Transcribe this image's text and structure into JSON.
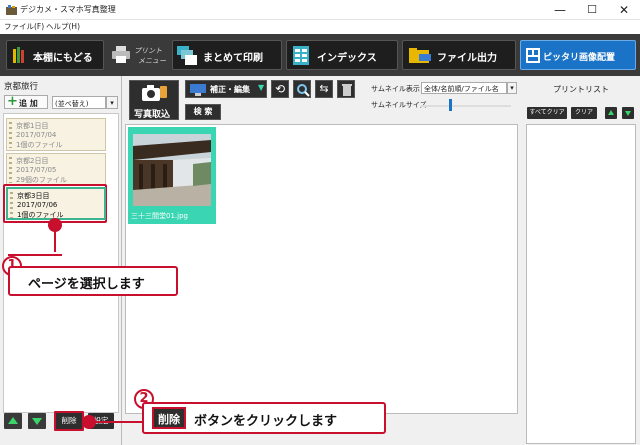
{
  "window": {
    "title": "デジカメ・スマホ写真整理",
    "minimize": "—",
    "maximize": "☐",
    "close": "✕"
  },
  "menu": {
    "file": "ファイル(F)",
    "help": "ヘルプ(H)"
  },
  "toolbar": {
    "back_to_shelf": "本棚にもどる",
    "print_menu_line1": "プリント",
    "print_menu_line2": "メニュー",
    "batch_print": "まとめて印刷",
    "index": "インデックス",
    "file_output": "ファイル出力",
    "fit_layout": "ピッタリ画像配置"
  },
  "left_panel": {
    "album_title": "京都旅行",
    "add_label": "追 加",
    "sort_label": "(並べ替え)",
    "pages": [
      {
        "title": "京都1日目",
        "date": "2017/07/04",
        "count": "1個のファイル",
        "selected": false
      },
      {
        "title": "京都2日目",
        "date": "2017/07/05",
        "count": "29個のファイル",
        "selected": false
      },
      {
        "title": "京都3日目",
        "date": "2017/07/06",
        "count": "1個のファイル",
        "selected": true
      }
    ],
    "delete_label": "削除",
    "settings_label": "設定"
  },
  "center": {
    "import_label": "写真取込",
    "edit_label": "補正・編集",
    "search_label": "検 索",
    "thumb_display_label": "サムネイル表示",
    "thumb_display_value": "全体/名前順/ファイル名",
    "thumb_size_label": "サムネイルサイズ",
    "thumbnails": [
      {
        "filename": "三十三間堂01.jpg"
      }
    ]
  },
  "right_panel": {
    "title": "プリントリスト",
    "select_all_label": "すべてクリア",
    "clear_label": "クリア"
  },
  "callouts": {
    "step1_number": "1",
    "step1_text": "ページを選択します",
    "step2_number": "2",
    "step2_button": "削除",
    "step2_text": "ボタンをクリックします"
  },
  "colors": {
    "accent_red": "#c8102e",
    "thumb_highlight": "#3ad6b4",
    "toolbar_bg": "#3a3a3a",
    "fit_button_bg": "#1a73c7"
  }
}
